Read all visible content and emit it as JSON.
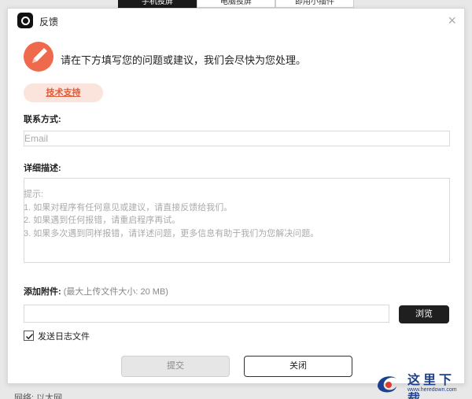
{
  "background": {
    "tabs": [
      "手机投屏",
      "电脑投屏",
      "即用小插件"
    ],
    "bottom_text": "网络: 以太网"
  },
  "dialog": {
    "title": "反馈",
    "close_glyph": "×",
    "heading": "请在下方填写您的问题或建议，我们会尽快为您处理。",
    "support_button": "技术支持",
    "contact_label": "联系方式:",
    "email_placeholder": "Email",
    "email_value": "",
    "description_label": "详细描述:",
    "description_hint": [
      "提示:",
      "1. 如果对程序有任何意见或建议，请直接反馈给我们。",
      "2. 如果遇到任何报错，请重启程序再试。",
      "3. 如果多次遇到同样报错，请详述问题，更多信息有助于我们为您解决问题。"
    ],
    "attachment_label": "添加附件:",
    "attachment_hint": "(最大上传文件大小: 20 MB)",
    "attachment_value": "",
    "browse_button": "浏览",
    "send_log_label": "发送日志文件",
    "send_log_checked": true,
    "submit_button": "提交",
    "close_button": "关闭"
  },
  "watermark": {
    "text": "这里下载",
    "url": "www.heredown.com"
  },
  "colors": {
    "accent": "#ef6a4c",
    "support_bg": "#fbe4dc",
    "dark_button": "#1f1f1f"
  },
  "icons": {
    "app": "app-logo-icon",
    "feedback": "pen-icon",
    "close": "close-icon",
    "check": "checkmark-icon"
  }
}
